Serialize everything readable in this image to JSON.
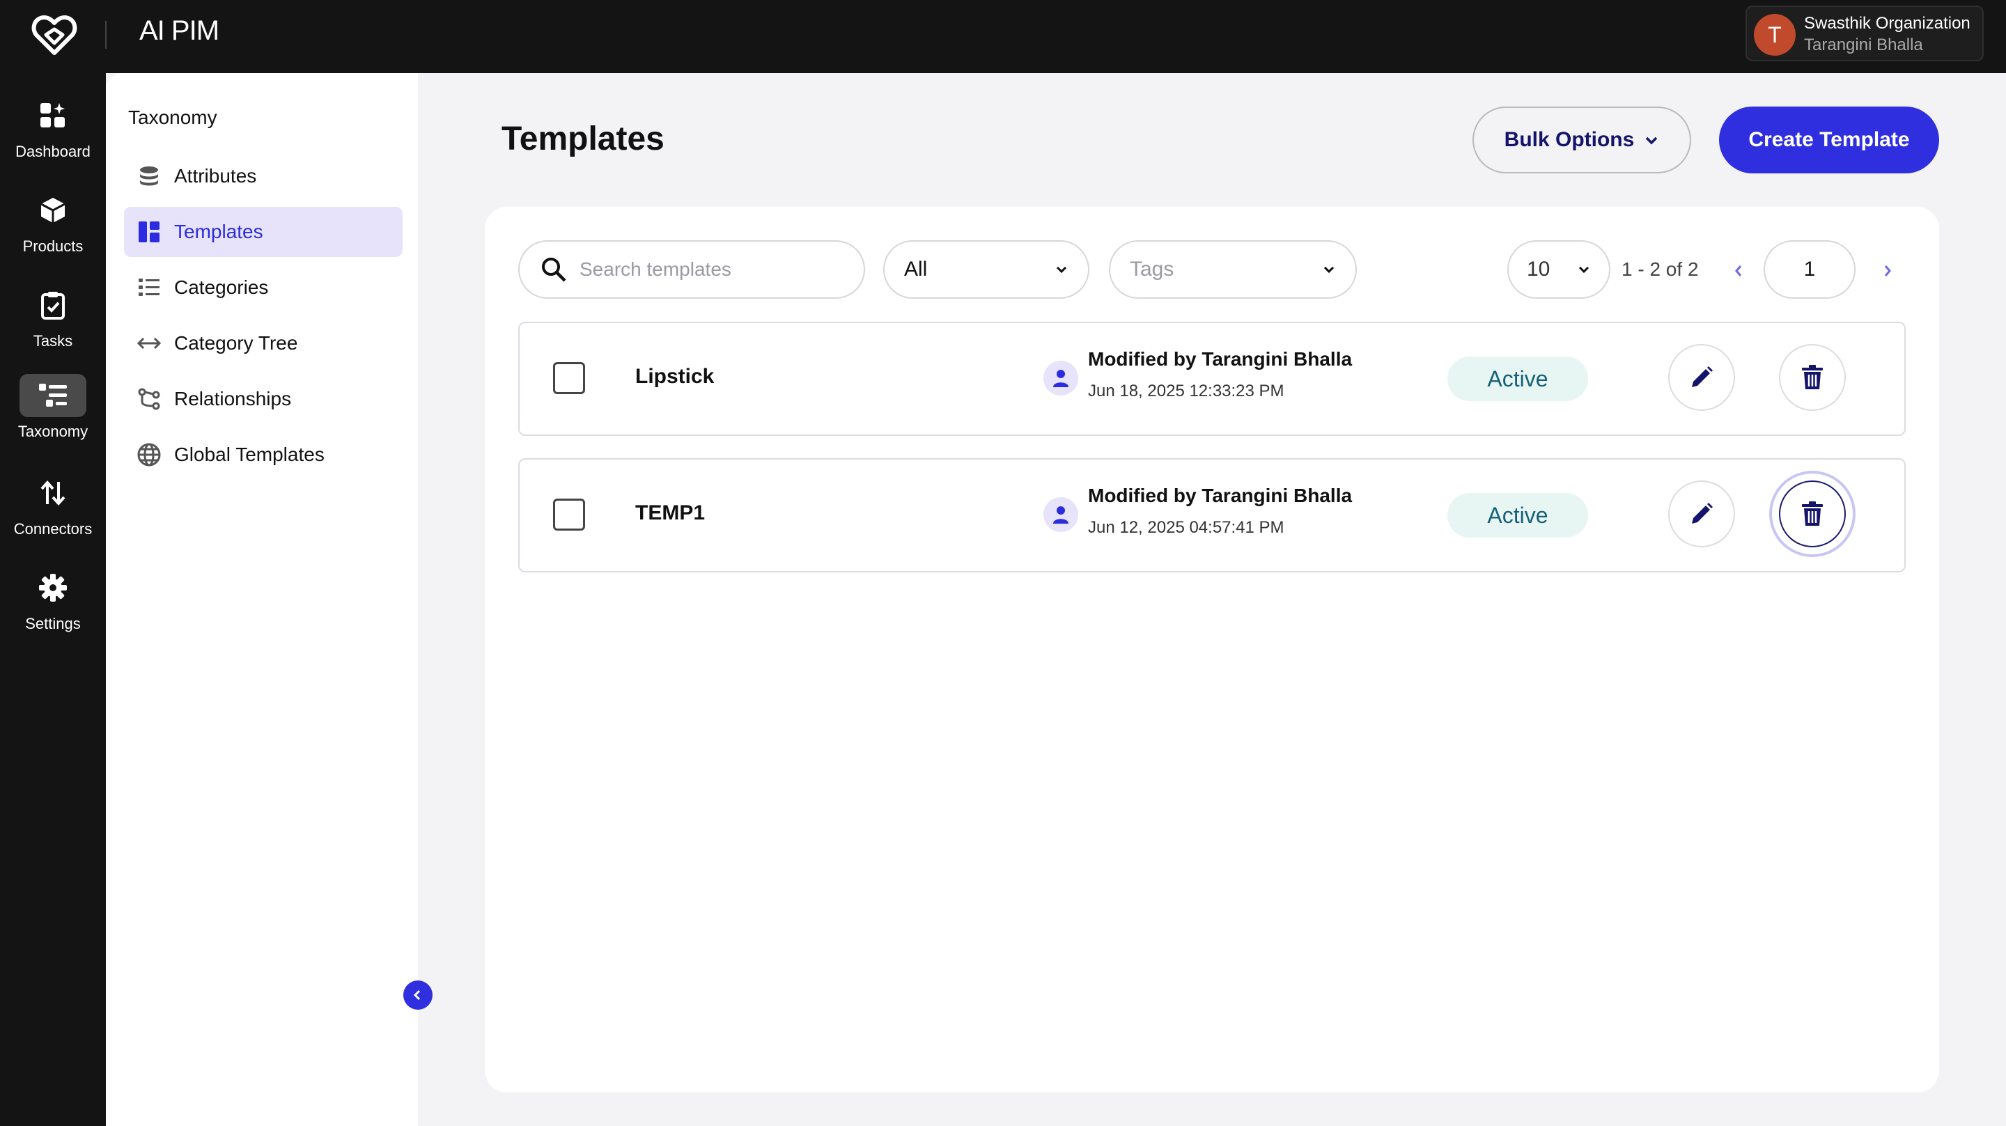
{
  "app": {
    "brand": "AI PIM"
  },
  "org": {
    "avatar_initial": "T",
    "name": "Swasthik Organization",
    "user": "Tarangini Bhalla"
  },
  "rail": {
    "items": [
      {
        "label": "Dashboard",
        "icon": "dashboard-icon"
      },
      {
        "label": "Products",
        "icon": "box-icon"
      },
      {
        "label": "Tasks",
        "icon": "clipboard-icon"
      },
      {
        "label": "Taxonomy",
        "icon": "taxonomy-icon",
        "active": true
      },
      {
        "label": "Connectors",
        "icon": "arrows-updown-icon"
      },
      {
        "label": "Settings",
        "icon": "gear-icon"
      }
    ]
  },
  "subnav": {
    "title": "Taxonomy",
    "items": [
      {
        "label": "Attributes",
        "icon": "database-icon"
      },
      {
        "label": "Templates",
        "icon": "template-icon",
        "active": true
      },
      {
        "label": "Categories",
        "icon": "list-icon"
      },
      {
        "label": "Category Tree",
        "icon": "arrows-horizontal-icon"
      },
      {
        "label": "Relationships",
        "icon": "relationship-icon"
      },
      {
        "label": "Global Templates",
        "icon": "globe-icon"
      }
    ]
  },
  "main": {
    "title": "Templates",
    "bulk_label": "Bulk Options",
    "create_label": "Create Template"
  },
  "toolbar": {
    "search_placeholder": "Search templates",
    "status_filter": "All",
    "tags_placeholder": "Tags",
    "page_size": "10",
    "range": "1 - 2 of 2",
    "current_page": "1"
  },
  "templates": [
    {
      "name": "Lipstick",
      "modified_by": "Modified by Tarangini Bhalla",
      "modified_at": "Jun 18, 2025 12:33:23 PM",
      "status": "Active"
    },
    {
      "name": "TEMP1",
      "modified_by": "Modified by Tarangini Bhalla",
      "modified_at": "Jun 12, 2025 04:57:41 PM",
      "status": "Active"
    }
  ],
  "colors": {
    "accent": "#2f2fe0",
    "dark": "#141414",
    "active_badge_bg": "#e7f6f2",
    "icon_navy": "#14146b"
  }
}
